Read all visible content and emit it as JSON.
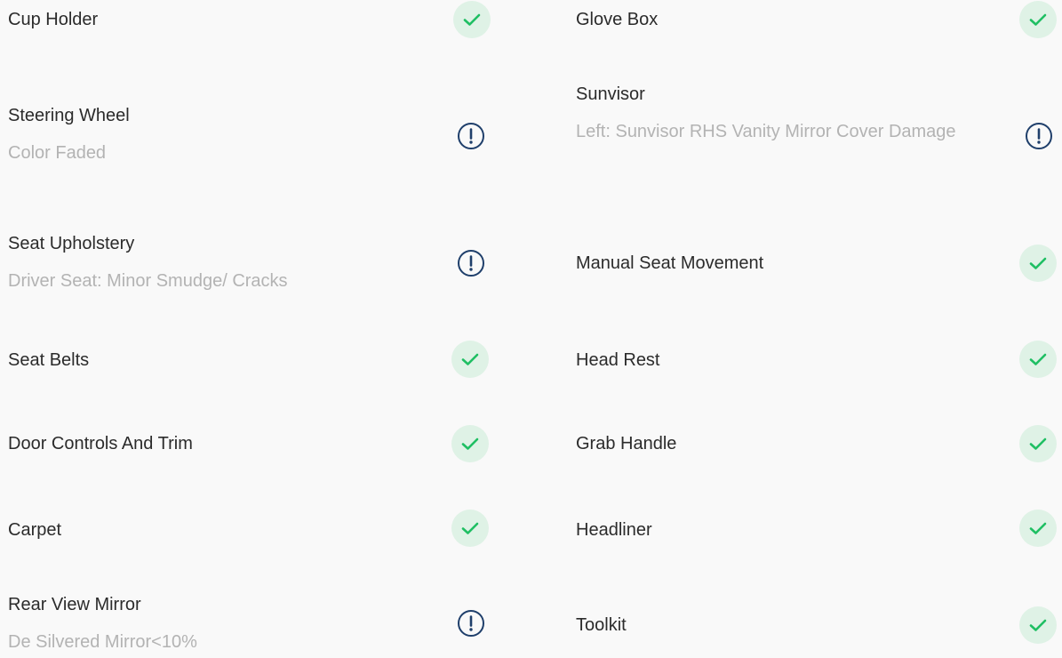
{
  "colors": {
    "title_text": "#2b2b2b",
    "subtitle_text": "#b3b3b3",
    "ok_icon": "#1fbf63",
    "ok_badge_bg": "#dff2e6",
    "warning_icon": "#1f3f6b",
    "background": "#f9f9f9"
  },
  "left_column": [
    {
      "title": "Cup Holder",
      "status": "ok",
      "icon": "check-icon"
    },
    {
      "title": "Steering Wheel",
      "subtitle": "Color Faded",
      "status": "warning",
      "icon": "exclamation-icon"
    },
    {
      "title": "Seat Upholstery",
      "subtitle": "Driver Seat: Minor Smudge/ Cracks",
      "status": "warning",
      "icon": "exclamation-icon"
    },
    {
      "title": "Seat Belts",
      "status": "ok",
      "icon": "check-icon"
    },
    {
      "title": "Door Controls And Trim",
      "status": "ok",
      "icon": "check-icon"
    },
    {
      "title": "Carpet",
      "status": "ok",
      "icon": "check-icon"
    },
    {
      "title": "Rear View Mirror",
      "subtitle": "De Silvered Mirror<10%",
      "status": "warning",
      "icon": "exclamation-icon"
    }
  ],
  "right_column": [
    {
      "title": "Glove Box",
      "status": "ok",
      "icon": "check-icon"
    },
    {
      "title": "Sunvisor",
      "subtitle": "Left: Sunvisor RHS Vanity Mirror Cover Damage",
      "status": "warning",
      "icon": "exclamation-icon"
    },
    {
      "title": "Manual Seat Movement",
      "status": "ok",
      "icon": "check-icon"
    },
    {
      "title": "Head Rest",
      "status": "ok",
      "icon": "check-icon"
    },
    {
      "title": "Grab Handle",
      "status": "ok",
      "icon": "check-icon"
    },
    {
      "title": "Headliner",
      "status": "ok",
      "icon": "check-icon"
    },
    {
      "title": "Toolkit",
      "status": "ok",
      "icon": "check-icon"
    }
  ]
}
